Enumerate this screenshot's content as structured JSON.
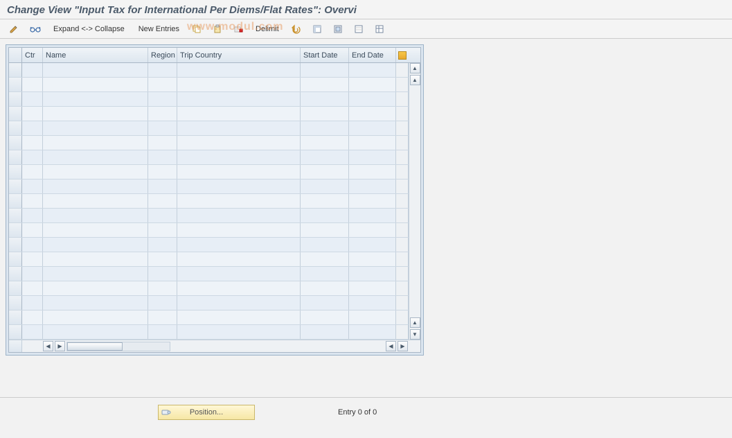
{
  "title": "Change View \"Input Tax for International Per Diems/Flat Rates\": Overvi",
  "toolbar": {
    "expand_collapse": "Expand <-> Collapse",
    "new_entries": "New Entries",
    "delimit": "Delimit"
  },
  "watermark": "www.modul.com",
  "columns": {
    "ctr": "Ctr",
    "name": "Name",
    "region": "Region",
    "trip_country": "Trip Country",
    "start_date": "Start Date",
    "end_date": "End Date"
  },
  "rows": [
    {
      "ctr": "",
      "name": "",
      "region": "",
      "trip_country": "",
      "start_date": "",
      "end_date": ""
    },
    {
      "ctr": "",
      "name": "",
      "region": "",
      "trip_country": "",
      "start_date": "",
      "end_date": ""
    },
    {
      "ctr": "",
      "name": "",
      "region": "",
      "trip_country": "",
      "start_date": "",
      "end_date": ""
    },
    {
      "ctr": "",
      "name": "",
      "region": "",
      "trip_country": "",
      "start_date": "",
      "end_date": ""
    },
    {
      "ctr": "",
      "name": "",
      "region": "",
      "trip_country": "",
      "start_date": "",
      "end_date": ""
    },
    {
      "ctr": "",
      "name": "",
      "region": "",
      "trip_country": "",
      "start_date": "",
      "end_date": ""
    },
    {
      "ctr": "",
      "name": "",
      "region": "",
      "trip_country": "",
      "start_date": "",
      "end_date": ""
    },
    {
      "ctr": "",
      "name": "",
      "region": "",
      "trip_country": "",
      "start_date": "",
      "end_date": ""
    },
    {
      "ctr": "",
      "name": "",
      "region": "",
      "trip_country": "",
      "start_date": "",
      "end_date": ""
    },
    {
      "ctr": "",
      "name": "",
      "region": "",
      "trip_country": "",
      "start_date": "",
      "end_date": ""
    },
    {
      "ctr": "",
      "name": "",
      "region": "",
      "trip_country": "",
      "start_date": "",
      "end_date": ""
    },
    {
      "ctr": "",
      "name": "",
      "region": "",
      "trip_country": "",
      "start_date": "",
      "end_date": ""
    },
    {
      "ctr": "",
      "name": "",
      "region": "",
      "trip_country": "",
      "start_date": "",
      "end_date": ""
    },
    {
      "ctr": "",
      "name": "",
      "region": "",
      "trip_country": "",
      "start_date": "",
      "end_date": ""
    },
    {
      "ctr": "",
      "name": "",
      "region": "",
      "trip_country": "",
      "start_date": "",
      "end_date": ""
    },
    {
      "ctr": "",
      "name": "",
      "region": "",
      "trip_country": "",
      "start_date": "",
      "end_date": ""
    },
    {
      "ctr": "",
      "name": "",
      "region": "",
      "trip_country": "",
      "start_date": "",
      "end_date": ""
    },
    {
      "ctr": "",
      "name": "",
      "region": "",
      "trip_country": "",
      "start_date": "",
      "end_date": ""
    },
    {
      "ctr": "",
      "name": "",
      "region": "",
      "trip_country": "",
      "start_date": "",
      "end_date": ""
    }
  ],
  "footer": {
    "position_btn": "Position...",
    "entry_text": "Entry 0 of 0"
  },
  "icons": {
    "pencil": "pencil-icon",
    "glasses": "glasses-icon",
    "copy": "copy-icon",
    "paste": "paste-icon",
    "delete": "delete-icon",
    "undo": "undo-icon",
    "select_all": "select-all-icon",
    "deselect_all": "deselect-all-icon",
    "save": "save-icon",
    "config": "configure-columns-icon",
    "key": "key-icon"
  }
}
